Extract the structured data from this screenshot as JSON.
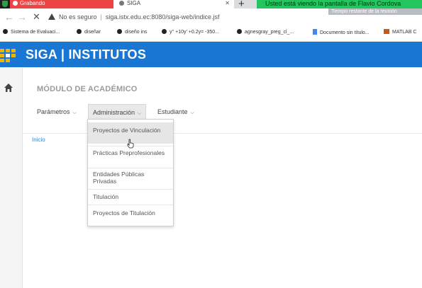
{
  "browser": {
    "tabs": [
      {
        "label": "Grabando"
      },
      {
        "label": "SIGA"
      }
    ],
    "new_tab_glyph": "+",
    "notification_banner": "Usted está viendo la pantalla de Flavio Cordova",
    "notification_sub": "Tiempo restante de la reunión",
    "address": {
      "security_label": "No es seguro",
      "url": "siga.istx.edu.ec:8080/siga-web/indice.jsf"
    },
    "bookmarks": [
      {
        "label": "Sistema de Evaluaci...",
        "icon": "globe-icon"
      },
      {
        "label": "diseñar",
        "icon": "globe-icon"
      },
      {
        "label": "diseño ins",
        "icon": "globe-icon"
      },
      {
        "label": "y'' +10y' +0.2y= -350...",
        "icon": "globe-icon"
      },
      {
        "label": "agnesgray_preg_cl_...",
        "icon": "globe-icon"
      },
      {
        "label": "Documento sin título...",
        "icon": "doc-icon"
      },
      {
        "label": "MATLAB C",
        "icon": "matlab-icon"
      }
    ]
  },
  "app": {
    "title": "SIGA | INSTITUTOS",
    "brand_color": "#1976d2",
    "accent_color": "#f4b400",
    "module_title": "MÓDULO DE ACADÉMICO",
    "menu": [
      {
        "label": "Parámetros",
        "active": false
      },
      {
        "label": "Administración",
        "active": true
      },
      {
        "label": "Estudiante",
        "active": false
      }
    ],
    "breadcrumb": "Inicio",
    "dropdown": [
      {
        "label": "Proyectos de Vinculación",
        "hover": true
      },
      {
        "label": "Prácticas Preprofesionales",
        "hover": false
      },
      {
        "label": "Entidades Públicas Privadas",
        "hover": false
      },
      {
        "label": "Titulación",
        "hover": false
      },
      {
        "label": "Proyectos de Titulación",
        "hover": false
      }
    ]
  }
}
